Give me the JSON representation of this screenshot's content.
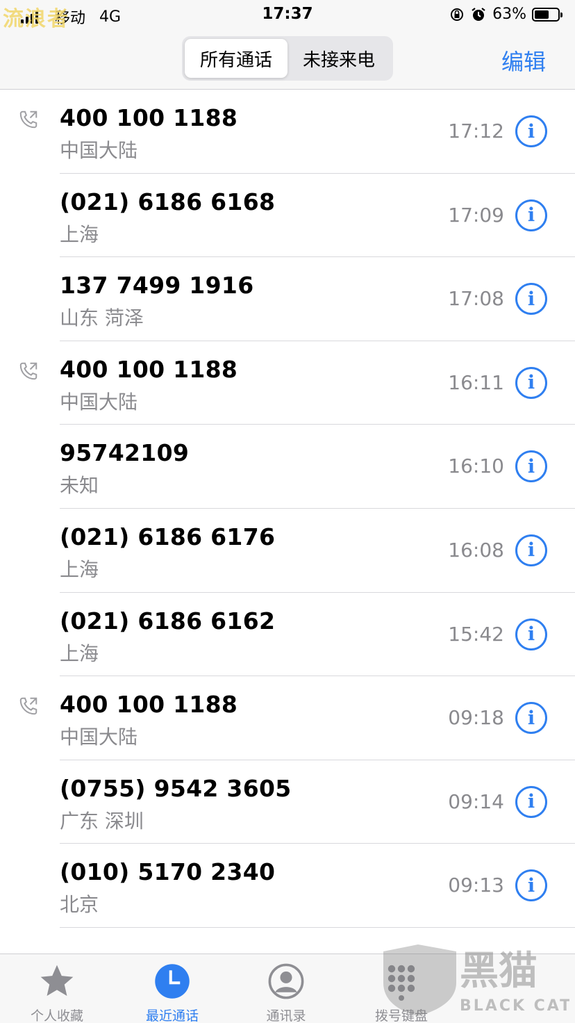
{
  "status_bar": {
    "carrier": "移动",
    "network": "4G",
    "time": "17:37",
    "battery_percent": "63%",
    "battery_level": 0.63
  },
  "watermark_text": "流浪者",
  "nav": {
    "segments": [
      "所有通话",
      "未接来电"
    ],
    "selected_segment": "所有通话",
    "edit_label": "编辑"
  },
  "calls": [
    {
      "number": "400 100 1188",
      "location": "中国大陆",
      "time": "17:12",
      "outgoing": true
    },
    {
      "number": "(021) 6186 6168",
      "location": "上海",
      "time": "17:09",
      "outgoing": false
    },
    {
      "number": "137 7499 1916",
      "location": "山东 菏泽",
      "time": "17:08",
      "outgoing": false
    },
    {
      "number": "400 100 1188",
      "location": "中国大陆",
      "time": "16:11",
      "outgoing": true
    },
    {
      "number": "95742109",
      "location": "未知",
      "time": "16:10",
      "outgoing": false
    },
    {
      "number": "(021) 6186 6176",
      "location": "上海",
      "time": "16:08",
      "outgoing": false
    },
    {
      "number": "(021) 6186 6162",
      "location": "上海",
      "time": "15:42",
      "outgoing": false
    },
    {
      "number": "400 100 1188",
      "location": "中国大陆",
      "time": "09:18",
      "outgoing": true
    },
    {
      "number": "(0755) 9542 3605",
      "location": "广东 深圳",
      "time": "09:14",
      "outgoing": false
    },
    {
      "number": "(010) 5170 2340",
      "location": "北京",
      "time": "09:13",
      "outgoing": false
    }
  ],
  "info_glyph": "i",
  "tabs": [
    {
      "label": "个人收藏",
      "icon": "star-icon",
      "active": false
    },
    {
      "label": "最近通话",
      "icon": "clock-icon",
      "active": true
    },
    {
      "label": "通讯录",
      "icon": "contact-icon",
      "active": false
    },
    {
      "label": "拨号键盘",
      "icon": "keypad-icon",
      "active": false
    }
  ],
  "brand_watermark": "黑猫 BLACK CAT",
  "colors": {
    "accent": "#2f7ff0",
    "secondary_text": "#8a8a8e",
    "bar_bg": "#f7f7f7"
  }
}
